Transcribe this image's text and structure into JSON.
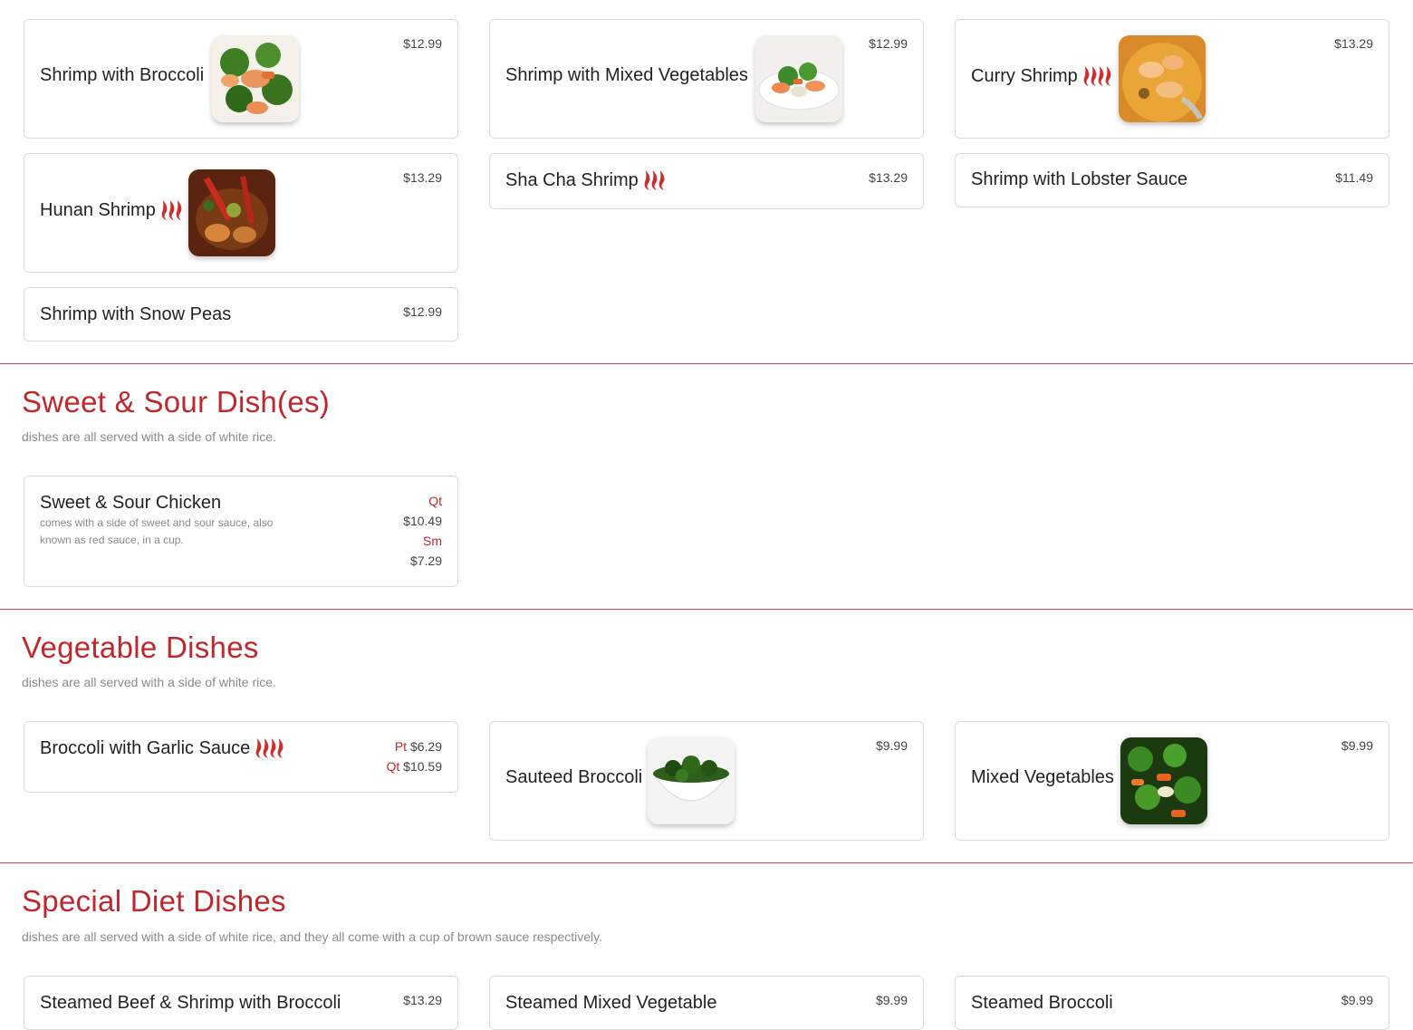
{
  "colors": {
    "accent": "#c0272d",
    "divider": "#c9484d",
    "card_border": "#dcdcdc"
  },
  "shrimp_section": {
    "items": [
      {
        "name": "Shrimp with Broccoli",
        "price": "$12.99",
        "image": "shrimp-broccoli-photo"
      },
      {
        "name": "Shrimp with Mixed Vegetables",
        "price": "$12.99",
        "image": "shrimp-mixed-veg-photo"
      },
      {
        "name": "Curry Shrimp",
        "price": "$13.29",
        "spicy": true,
        "image": "curry-shrimp-photo"
      },
      {
        "name": "Hunan Shrimp",
        "price": "$13.29",
        "spicy": true,
        "image": "hunan-shrimp-photo"
      },
      {
        "name": "Sha Cha Shrimp",
        "price": "$13.29",
        "spicy": true
      },
      {
        "name": "Shrimp with Lobster Sauce",
        "price": "$11.49"
      },
      {
        "name": "Shrimp with Snow Peas",
        "price": "$12.99"
      }
    ]
  },
  "sweet_sour": {
    "title": "Sweet & Sour Dish(es)",
    "description": "dishes are all served with a side of white rice.",
    "items": [
      {
        "name": "Sweet & Sour Chicken",
        "description": "comes with a side of sweet and sour sauce, also known as red sauce, in a cup.",
        "size1_label": "Qt",
        "size1_price": "$10.49",
        "size2_label": "Sm",
        "size2_price": "$7.29"
      }
    ]
  },
  "vegetable": {
    "title": "Vegetable Dishes",
    "description": "dishes are all served with a side of white rice.",
    "items": [
      {
        "name": "Broccoli with Garlic Sauce",
        "spicy": true,
        "size1_label": "Pt",
        "size1_price": "$6.29",
        "size2_label": "Qt",
        "size2_price": "$10.59"
      },
      {
        "name": "Sauteed Broccoli",
        "price": "$9.99",
        "image": "sauteed-broccoli-photo"
      },
      {
        "name": "Mixed Vegetables",
        "price": "$9.99",
        "image": "mixed-vegetables-photo"
      }
    ]
  },
  "special_diet": {
    "title": "Special Diet Dishes",
    "description": "dishes are all served with a side of white rice, and they all come with a cup of brown sauce respectively.",
    "items": [
      {
        "name": "Steamed Beef & Shrimp with Broccoli",
        "price": "$13.29"
      },
      {
        "name": "Steamed Mixed Vegetable",
        "price": "$9.99"
      },
      {
        "name": "Steamed Broccoli",
        "price": "$9.99"
      }
    ]
  }
}
